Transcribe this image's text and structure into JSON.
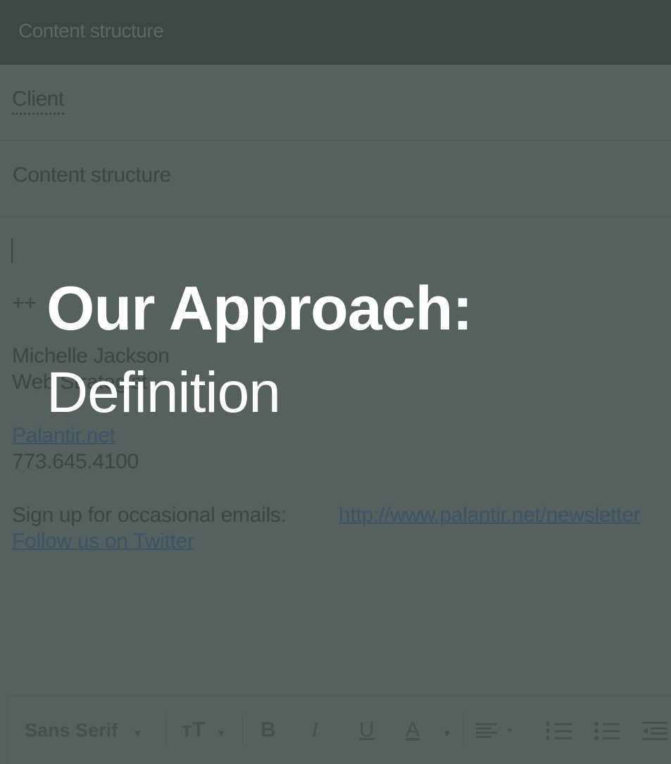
{
  "window": {
    "title": "Content structure"
  },
  "compose": {
    "to_chip": "Client",
    "subject": "Content structure"
  },
  "signature": {
    "separator": "++",
    "name": "Michelle Jackson",
    "role": "Web Strategist",
    "website": "Palantir.net",
    "phone": "773.645.4100",
    "newsletter_prefix": "Sign up for occasional emails:",
    "newsletter_link": "http://www.palantir.net/newsletter",
    "twitter_link": "Follow us on Twitter"
  },
  "overlay": {
    "title": "Our Approach:",
    "subtitle": "Definition"
  },
  "toolbar": {
    "font": "Sans Serif",
    "size_icon": "ᴛT",
    "bold": "B",
    "italic": "I",
    "underline": "U",
    "text_color": "A"
  },
  "colors": {
    "background": "#55605f",
    "titlebar": "#3d4746",
    "overlay_text": "#ffffff"
  }
}
